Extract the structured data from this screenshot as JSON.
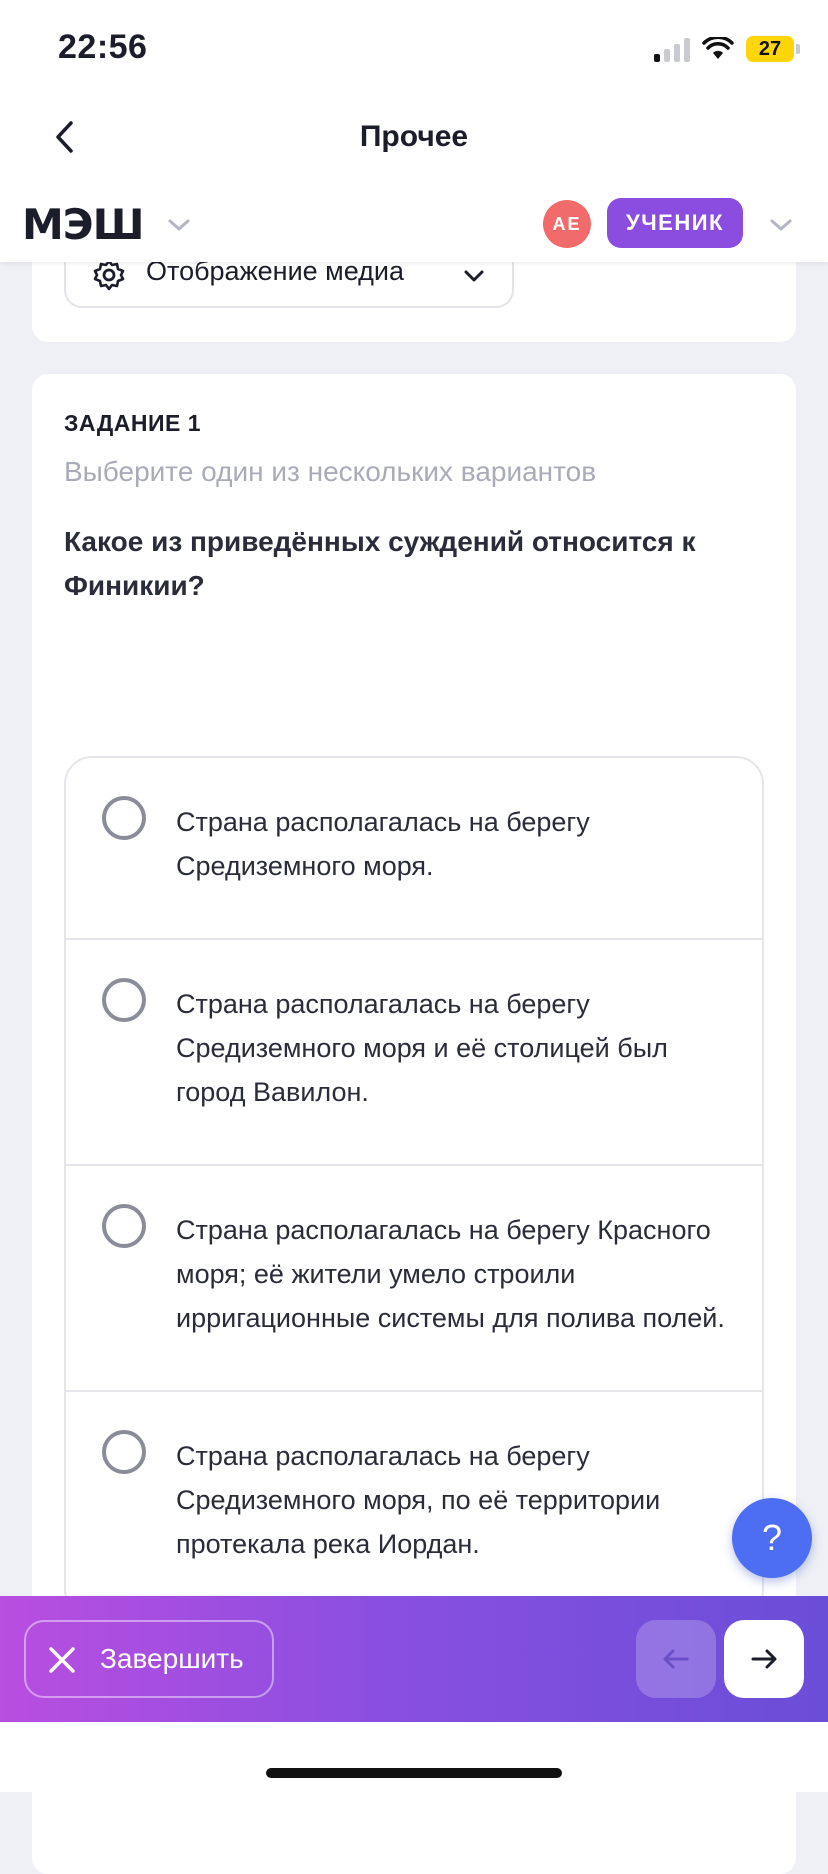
{
  "status_bar": {
    "time": "22:56",
    "battery": "27",
    "battery_color": "#ffd60a"
  },
  "nav": {
    "back_icon": "chevron-left-icon",
    "title": "Прочее"
  },
  "app_bar": {
    "logo": "МЭШ",
    "avatar_initials": "АЕ",
    "avatar_color": "#f26b6b",
    "role": "УЧЕНИК",
    "role_color": "#8b4de0"
  },
  "media": {
    "label": "Отображение медиа",
    "icon": "gear-icon"
  },
  "task": {
    "number": "ЗАДАНИЕ 1",
    "hint": "Выберите один из нескольких вариантов",
    "question": "Какое из приведённых суждений относится к Финикии?",
    "options": [
      {
        "text": "Страна располагалась на берегу Средиземного моря."
      },
      {
        "text": "Страна располагалась на берегу Средиземного моря и её столицей был город Вавилон."
      },
      {
        "text": "Страна располагалась на берегу Красного моря; её жители умело строили ирригационные системы для полива полей."
      },
      {
        "text": "Страна располагалась на берегу Средиземного моря, по её территории протекала река Иордан."
      }
    ]
  },
  "help": {
    "label": "?",
    "color": "#4d6ef2"
  },
  "actions": {
    "finish_label": "Завершить",
    "prev_icon": "arrow-left-icon",
    "next_icon": "arrow-right-icon"
  }
}
